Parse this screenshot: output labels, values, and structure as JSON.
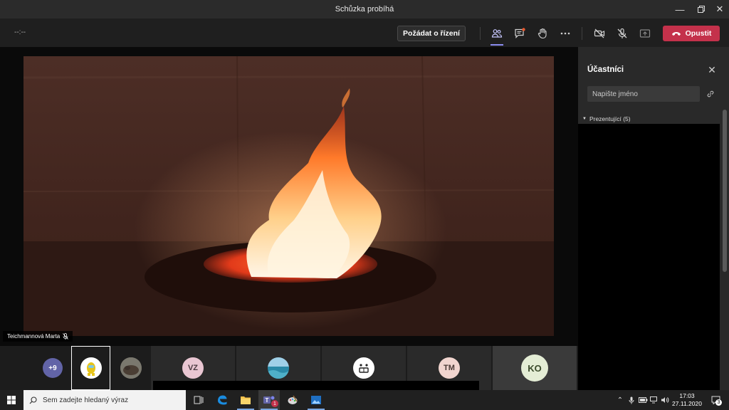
{
  "window": {
    "title": "Schůzka probíhá"
  },
  "toolbar": {
    "timer": "--:--",
    "request_control_label": "Požádat o řízení",
    "leave_label": "Opustit",
    "leave_color": "#c4314b"
  },
  "presenter": {
    "name": "Teichmannová Marta"
  },
  "strip": {
    "overflow_label": "+9",
    "participants": [
      {
        "initials": "VZ",
        "color": "#e9c6d2"
      },
      {
        "initials": "TM",
        "color": "#f1d5cf"
      },
      {
        "initials": "KO",
        "color": "#e4edd5"
      }
    ]
  },
  "panel": {
    "title": "Účastníci",
    "search_placeholder": "Napište jméno",
    "section_presenters": "Prezentující (5)"
  },
  "taskbar": {
    "search_placeholder": "Sem zadejte hledaný výraz",
    "time": "17:03",
    "date": "27.11.2020",
    "teams_badge": "1",
    "notifications_count": "3"
  }
}
